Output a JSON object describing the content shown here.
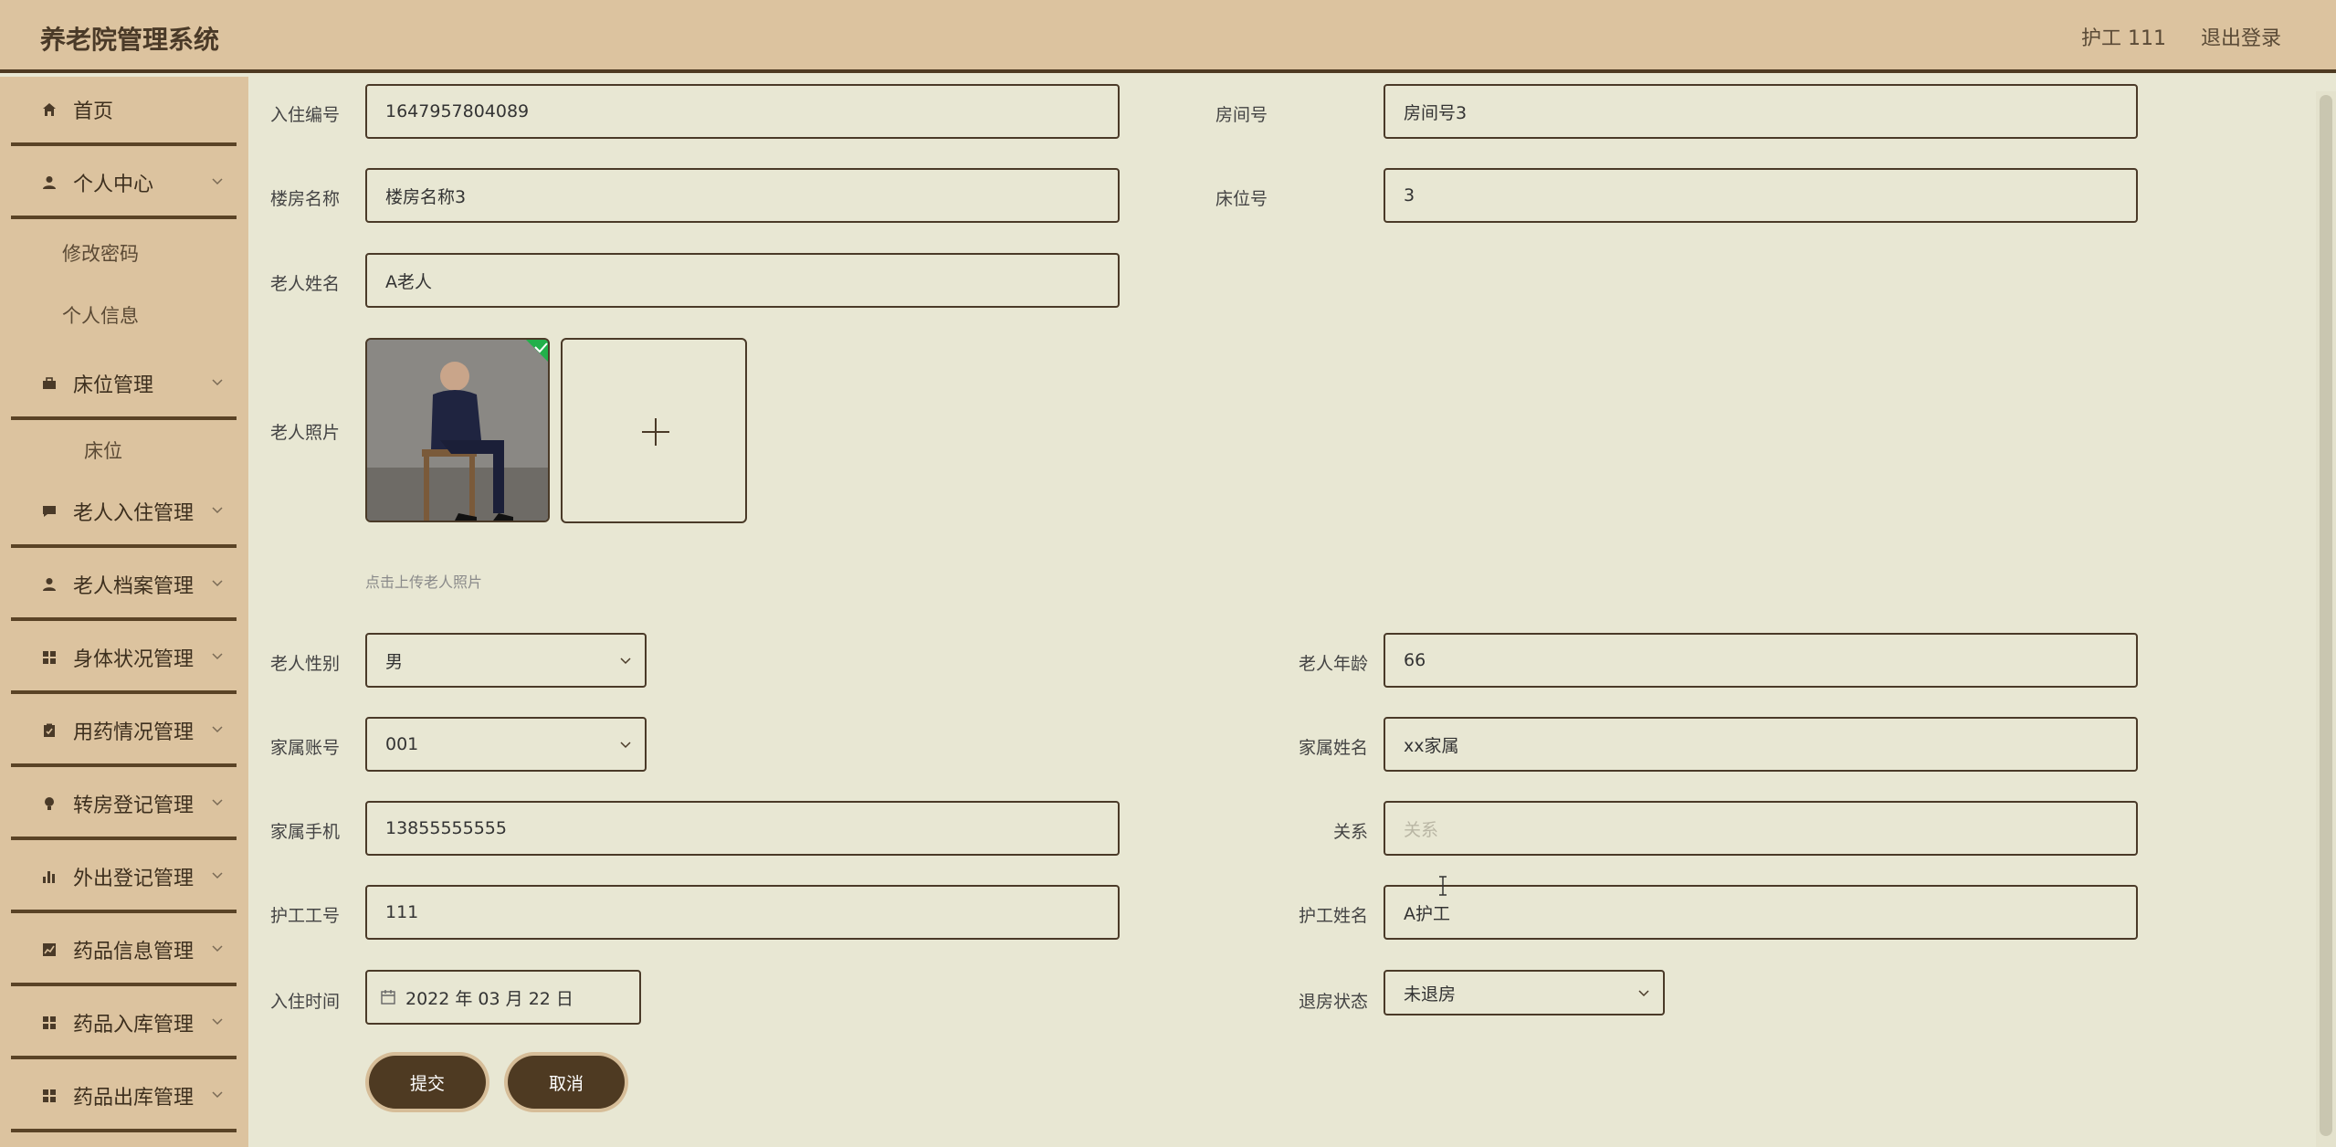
{
  "header": {
    "title": "养老院管理系统",
    "user": "护工 111",
    "logout": "退出登录"
  },
  "sidebar": {
    "items": [
      {
        "label": "首页",
        "icon": "home-icon"
      },
      {
        "label": "个人中心",
        "icon": "person-icon"
      },
      {
        "label": "床位管理",
        "icon": "briefcase-icon"
      },
      {
        "label": "老人入住管理",
        "icon": "chat-icon"
      },
      {
        "label": "老人档案管理",
        "icon": "person-icon"
      },
      {
        "label": "身体状况管理",
        "icon": "grid-icon"
      },
      {
        "label": "用药情况管理",
        "icon": "clipboard-icon"
      },
      {
        "label": "转房登记管理",
        "icon": "bulb-icon"
      },
      {
        "label": "外出登记管理",
        "icon": "bar-chart-icon"
      },
      {
        "label": "药品信息管理",
        "icon": "line-chart-icon"
      },
      {
        "label": "药品入库管理",
        "icon": "grid-icon"
      },
      {
        "label": "药品出库管理",
        "icon": "grid-icon"
      }
    ],
    "sub_items": {
      "change_password": "修改密码",
      "profile": "个人信息",
      "bed": "床位"
    }
  },
  "form": {
    "checkin_no": {
      "label": "入住编号",
      "value": "1647957804089"
    },
    "room_no": {
      "label": "房间号",
      "value": "房间号3"
    },
    "building": {
      "label": "楼房名称",
      "value": "楼房名称3"
    },
    "bed_no": {
      "label": "床位号",
      "value": "3"
    },
    "elder_name": {
      "label": "老人姓名",
      "value": "A老人"
    },
    "elder_photo": {
      "label": "老人照片",
      "hint": "点击上传老人照片"
    },
    "gender": {
      "label": "老人性别",
      "value": "男"
    },
    "age": {
      "label": "老人年龄",
      "value": "66"
    },
    "family_account": {
      "label": "家属账号",
      "value": "001"
    },
    "family_name": {
      "label": "家属姓名",
      "value": "xx家属"
    },
    "family_phone": {
      "label": "家属手机",
      "value": "13855555555"
    },
    "relation": {
      "label": "关系",
      "placeholder": "关系"
    },
    "nurse_id": {
      "label": "护工工号",
      "value": "111"
    },
    "nurse_name": {
      "label": "护工姓名",
      "value": "A护工"
    },
    "checkin_time": {
      "label": "入住时间",
      "value": "2022 年 03 月 22 日"
    },
    "checkout_status": {
      "label": "退房状态",
      "value": "未退房"
    }
  },
  "buttons": {
    "submit": "提交",
    "cancel": "取消"
  },
  "colors": {
    "header_bg": "#dcc39f",
    "content_bg": "#e8e7d3",
    "accent": "#4e3a22"
  }
}
